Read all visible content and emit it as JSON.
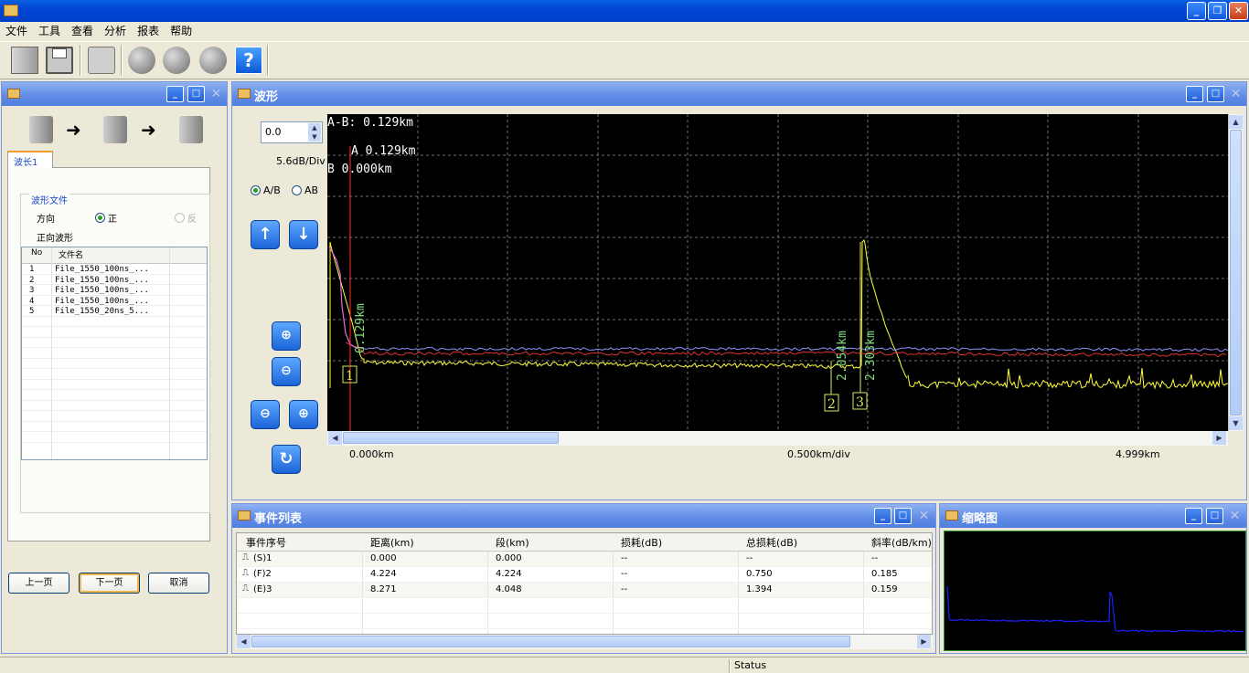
{
  "menu": [
    "文件",
    "工具",
    "查看",
    "分析",
    "报表",
    "帮助"
  ],
  "toolbar": {
    "icons": [
      "new-document-icon",
      "save-icon",
      "print-icon",
      "edit-icon",
      "globe-icon",
      "settings-globe-icon",
      "help-icon"
    ],
    "help_label": "?"
  },
  "left_panel": {
    "tab": "波长1",
    "group_title": "波形文件",
    "direction_label": "方向",
    "forward_label": "正",
    "reverse_label": "反",
    "forward_wave_label": "正向波形",
    "columns": [
      "No",
      "文件名"
    ],
    "files": [
      {
        "no": "1",
        "name": "File_1550_100ns_..."
      },
      {
        "no": "2",
        "name": "File_1550_100ns_..."
      },
      {
        "no": "3",
        "name": "File_1550_100ns_..."
      },
      {
        "no": "4",
        "name": "File_1550_100ns_..."
      },
      {
        "no": "5",
        "name": "File_1550_20ns_5..."
      }
    ],
    "prev_button": "上一页",
    "next_button": "下一页",
    "cancel_button": "取消"
  },
  "waveform": {
    "title": "波形",
    "offset_value": "0.0",
    "scale": "5.6dB/Div",
    "radio_ab_slash": "A/B",
    "radio_ab": "AB",
    "readout_ab": "A-B: 0.129km",
    "readout_a": "A 0.129km",
    "readout_b": "B 0.000km",
    "marker_a_label": "0.129km",
    "marker_2_label": "2.054km",
    "marker_3_label": "2.303km",
    "event_markers": [
      "1",
      "2",
      "3"
    ],
    "x_start": "0.000km",
    "x_div": "0.500km/div",
    "x_end": "4.999km",
    "colors": {
      "trace_yellow": "#ffff3a",
      "trace_pink": "#e070e0",
      "trace_red": "#e03030",
      "trace_blue": "#9090ff",
      "marker_a": "#ff3030",
      "grid": "#707070"
    }
  },
  "events": {
    "title": "事件列表",
    "columns": [
      "事件序号",
      "距离(km)",
      "段(km)",
      "损耗(dB)",
      "总损耗(dB)",
      "斜率(dB/km)"
    ],
    "rows": [
      {
        "id": "(S)1",
        "distance": "0.000",
        "section": "0.000",
        "loss": "--",
        "total": "--",
        "slope": "--"
      },
      {
        "id": "(F)2",
        "distance": "4.224",
        "section": "4.224",
        "loss": "--",
        "total": "0.750",
        "slope": "0.185"
      },
      {
        "id": "(E)3",
        "distance": "8.271",
        "section": "4.048",
        "loss": "--",
        "total": "1.394",
        "slope": "0.159"
      }
    ]
  },
  "thumbnail": {
    "title": "缩略图",
    "trace_color": "#2020ff"
  },
  "status": {
    "text": "Status"
  }
}
